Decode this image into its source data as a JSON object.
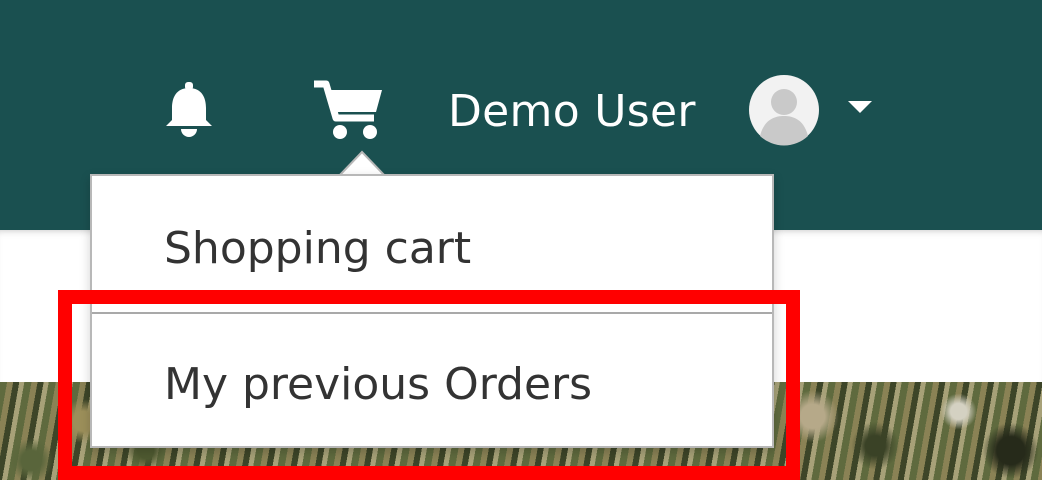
{
  "header": {
    "notifications_icon": "bell-icon",
    "cart_icon": "shopping-cart-icon",
    "user_name": "Demo User",
    "avatar_icon": "user-avatar-icon",
    "menu_toggle_icon": "caret-down-icon",
    "background_color": "#1a5050"
  },
  "cart_menu": {
    "items": [
      {
        "label": "Shopping cart"
      },
      {
        "label": "My previous Orders",
        "highlighted": true
      }
    ]
  },
  "colors": {
    "highlight": "#ff0000",
    "menu_text": "#333333"
  }
}
